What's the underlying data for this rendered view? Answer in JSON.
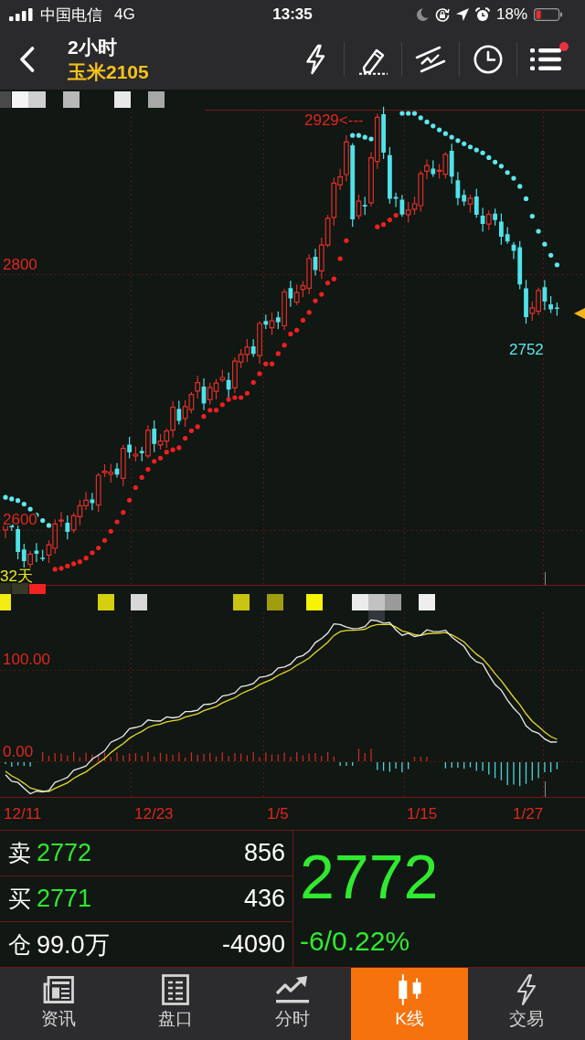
{
  "status_bar": {
    "carrier": "中国电信",
    "network": "4G",
    "time": "13:35",
    "battery": "18%"
  },
  "header": {
    "period": "2小时",
    "symbol": "玉米2105",
    "menu_badge": true
  },
  "price_chart": {
    "axis_labels": [
      "2800",
      "2600"
    ],
    "high_label": "2929<---",
    "low_label": "2752",
    "days_label": "32天"
  },
  "indicator_chart": {
    "axis_labels": [
      "100.00",
      "0.00"
    ]
  },
  "date_labels": [
    "12/11",
    "12/23",
    "1/5",
    "1/15",
    "1/27"
  ],
  "quote": {
    "rows": [
      {
        "kind": "ask",
        "label": "卖",
        "price": "2772",
        "volume": "856"
      },
      {
        "kind": "bid",
        "label": "买",
        "price": "2771",
        "volume": "436"
      },
      {
        "kind": "position",
        "label": "仓",
        "price": "99.0万",
        "volume": "-4090"
      }
    ],
    "last_price": "2772",
    "change": "-6/0.22%"
  },
  "tabs": [
    {
      "label": "资讯",
      "selected": false
    },
    {
      "label": "盘口",
      "selected": false
    },
    {
      "label": "分时",
      "selected": false
    },
    {
      "label": "K线",
      "selected": true
    },
    {
      "label": "交易",
      "selected": false
    }
  ]
}
